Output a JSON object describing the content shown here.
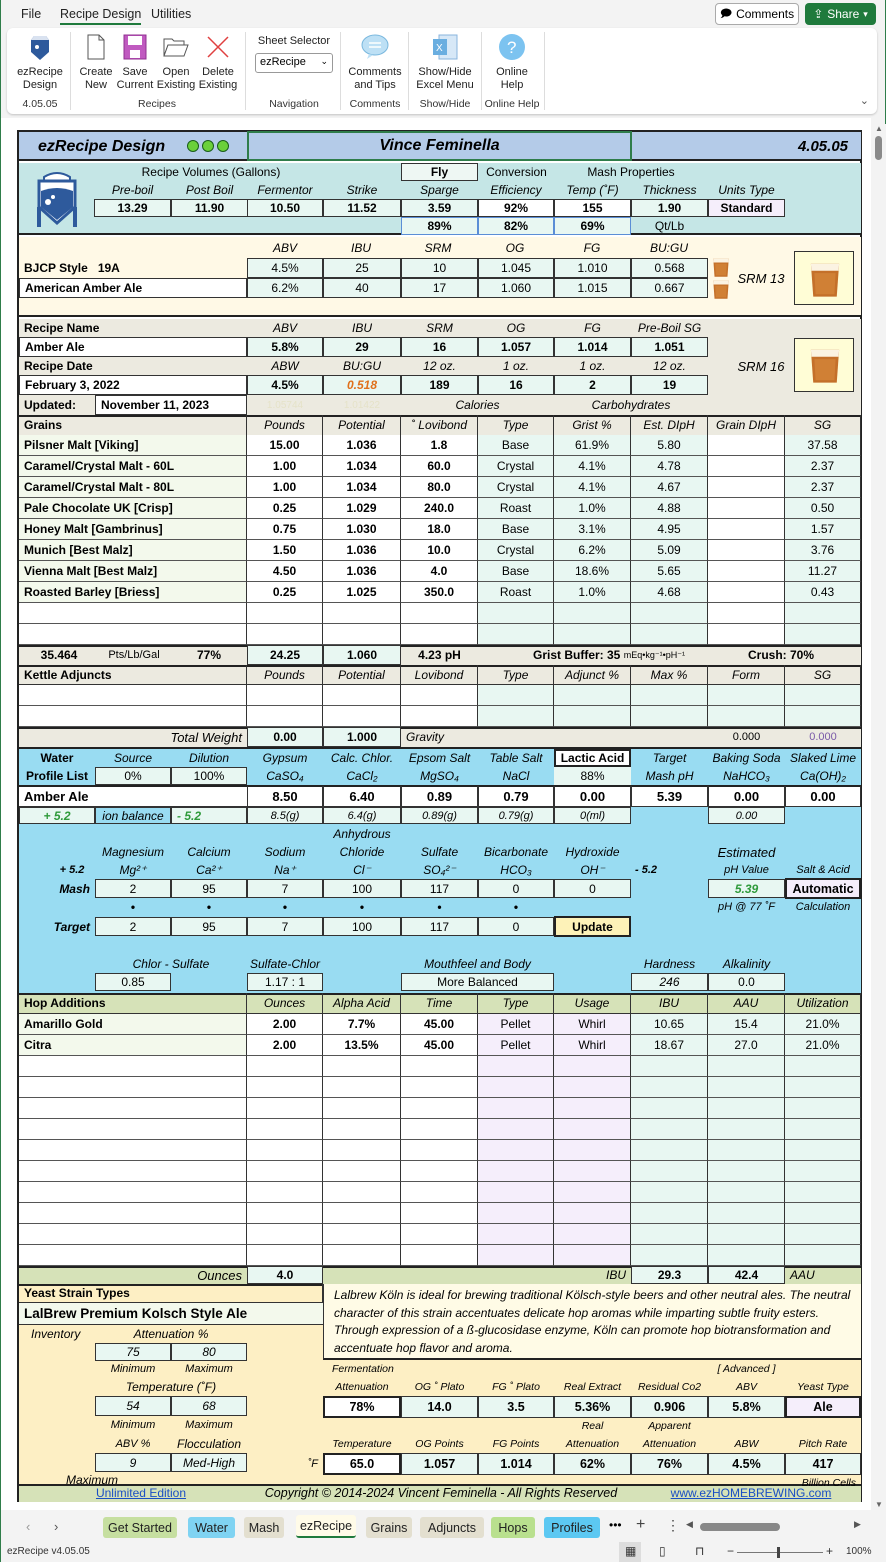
{
  "menubar": {
    "items": [
      "File",
      "Recipe Design",
      "Utilities"
    ],
    "active": "Recipe Design",
    "comments_label": "Comments",
    "share_label": "Share"
  },
  "ribbon": {
    "app_button": {
      "line1": "ezRecipe",
      "line2": "Design",
      "version": "4.05.05"
    },
    "create": {
      "line1": "Create",
      "line2": "New"
    },
    "save": {
      "line1": "Save",
      "line2": "Current"
    },
    "open": {
      "line1": "Open",
      "line2": "Existing"
    },
    "delete": {
      "line1": "Delete",
      "line2": "Existing"
    },
    "recipes_group": "Recipes",
    "sheet_selector_label": "Sheet Selector",
    "sheet_selector_value": "ezRecipe",
    "navigation_group": "Navigation",
    "comments": {
      "line1": "Comments",
      "line2": "and Tips"
    },
    "comments_group": "Comments",
    "showhide": {
      "line1": "Show/Hide",
      "line2": "Excel Menu"
    },
    "showhide_group": "Show/Hide",
    "help": {
      "line1": "Online",
      "line2": "Help"
    },
    "help_group": "Online Help"
  },
  "header": {
    "title": "ezRecipe Design",
    "brewer": "Vince Feminella",
    "version": "4.05.05"
  },
  "volumes": {
    "section_label": "Recipe Volumes (Gallons)",
    "sparge_mode": "Fly",
    "conversion_label": "Conversion",
    "mash_props_label": "Mash Properties",
    "headers": [
      "Pre-boil",
      "Post Boil",
      "Fermentor",
      "Strike",
      "Sparge",
      "Efficiency",
      "Temp (˚F)",
      "Thickness",
      "Units Type"
    ],
    "values": [
      "13.29",
      "11.90",
      "10.50",
      "11.52",
      "3.59",
      "92%",
      "155",
      "1.90",
      "Standard"
    ],
    "row2": [
      "89%",
      "82%",
      "69%",
      "Qt/Lb"
    ]
  },
  "style": {
    "headers": [
      "ABV",
      "IBU",
      "SRM",
      "OG",
      "FG",
      "BU:GU"
    ],
    "bjcp_label": "BJCP Style",
    "bjcp_code": "19A",
    "style_name": "American Amber Ale",
    "min": [
      "4.5%",
      "25",
      "10",
      "1.045",
      "1.010",
      "0.568"
    ],
    "max": [
      "6.2%",
      "40",
      "17",
      "1.060",
      "1.015",
      "0.667"
    ],
    "srm_label": "SRM 13"
  },
  "recipe": {
    "name_label": "Recipe Name",
    "name": "Amber Ale",
    "headers": [
      "ABV",
      "IBU",
      "SRM",
      "OG",
      "FG",
      "Pre-Boil SG"
    ],
    "values": [
      "5.8%",
      "29",
      "16",
      "1.057",
      "1.014",
      "1.051"
    ],
    "date_label": "Recipe Date",
    "date": "February 3, 2022",
    "headers2": [
      "ABW",
      "BU:GU",
      "12 oz.",
      "1 oz.",
      "1 oz.",
      "12 oz."
    ],
    "values2": [
      "4.5%",
      "0.518",
      "189",
      "16",
      "2",
      "19"
    ],
    "updated_label": "Updated:",
    "updated": "November 11, 2023",
    "hidden1": "1.05744",
    "hidden2": "1.01422",
    "calories_label": "Calories",
    "carbs_label": "Carbohydrates",
    "srm_label": "SRM 16"
  },
  "grains": {
    "headers": [
      "Grains",
      "Pounds",
      "Potential",
      "˚ Lovibond",
      "Type",
      "Grist %",
      "Est. DIpH",
      "Grain DIpH",
      "SG"
    ],
    "rows": [
      [
        "Pilsner Malt [Viking]",
        "15.00",
        "1.036",
        "1.8",
        "Base",
        "61.9%",
        "5.80",
        "",
        "37.58"
      ],
      [
        "Caramel/Crystal Malt - 60L",
        "1.00",
        "1.034",
        "60.0",
        "Crystal",
        "4.1%",
        "4.78",
        "",
        "2.37"
      ],
      [
        "Caramel/Crystal Malt - 80L",
        "1.00",
        "1.034",
        "80.0",
        "Crystal",
        "4.1%",
        "4.67",
        "",
        "2.37"
      ],
      [
        "Pale Chocolate UK [Crisp]",
        "0.25",
        "1.029",
        "240.0",
        "Roast",
        "1.0%",
        "4.88",
        "",
        "0.50"
      ],
      [
        "Honey Malt [Gambrinus]",
        "0.75",
        "1.030",
        "18.0",
        "Base",
        "3.1%",
        "4.95",
        "",
        "1.57"
      ],
      [
        "Munich [Best Malz]",
        "1.50",
        "1.036",
        "10.0",
        "Crystal",
        "6.2%",
        "5.09",
        "",
        "3.76"
      ],
      [
        "Vienna Malt [Best Malz]",
        "4.50",
        "1.036",
        "4.0",
        "Base",
        "18.6%",
        "5.65",
        "",
        "11.27"
      ],
      [
        "Roasted Barley [Briess]",
        "0.25",
        "1.025",
        "350.0",
        "Roast",
        "1.0%",
        "4.68",
        "",
        "0.43"
      ],
      [
        "",
        "",
        "",
        "",
        "",
        "",
        "",
        "",
        ""
      ],
      [
        "",
        "",
        "",
        "",
        "",
        "",
        "",
        "",
        ""
      ]
    ],
    "totals": {
      "pts": "35.464",
      "pts_unit": "Pts/Lb/Gal",
      "eff": "77%",
      "pounds": "24.25",
      "gravity": "1.060",
      "ph": "4.23 pH",
      "buffer_label": "Grist Buffer:",
      "buffer": "35",
      "buffer_unit": "mEq•kg⁻¹•pH⁻¹",
      "crush": "Crush: 70%"
    }
  },
  "adjuncts": {
    "headers": [
      "Kettle Adjuncts",
      "Pounds",
      "Potential",
      "Lovibond",
      "Type",
      "Adjunct %",
      "Max %",
      "Form",
      "SG"
    ],
    "rows": [
      [
        "",
        "",
        "",
        "",
        "",
        "",
        "",
        "",
        ""
      ],
      [
        "",
        "",
        "",
        "",
        "",
        "",
        "",
        "",
        ""
      ]
    ],
    "total_weight_label": "Total Weight",
    "total_weight": "0.00",
    "total_gravity": "1.000",
    "gravity_label": "Gravity",
    "form_total": "0.000",
    "sg_total": "0.000"
  },
  "water": {
    "water_label": "Water",
    "profile_list_label": "Profile List",
    "source_label": "Source",
    "source": "0%",
    "dilution_label": "Dilution",
    "dilution": "100%",
    "salt_headers": [
      [
        "Gypsum",
        "CaSO₄"
      ],
      [
        "Calc. Chlor.",
        "CaCl₂"
      ],
      [
        "Epsom Salt",
        "MgSO₄"
      ],
      [
        "Table Salt",
        "NaCl"
      ],
      [
        "Lactic Acid",
        "88%"
      ],
      [
        "Target",
        "Mash pH"
      ],
      [
        "Baking Soda",
        "NaHCO₃"
      ],
      [
        "Slaked Lime",
        "Ca(OH)₂"
      ]
    ],
    "profile": "Amber Ale",
    "salt_values": [
      "8.50",
      "6.40",
      "0.89",
      "0.79",
      "0.00",
      "5.39",
      "0.00",
      "0.00"
    ],
    "ion_plus": "+ 5.2",
    "ion_label": "ion balance",
    "ion_minus": "- 5.2",
    "salt_grams": [
      "8.5(g)",
      "6.4(g)",
      "0.89(g)",
      "0.79(g)",
      "0(ml)",
      "",
      "0.00",
      ""
    ],
    "anhydrous_label": "Anhydrous",
    "ion_headers": [
      [
        "Magnesium",
        "Mg²⁺"
      ],
      [
        "Calcium",
        "Ca²⁺"
      ],
      [
        "Sodium",
        "Na⁺"
      ],
      [
        "Chloride",
        "Cl⁻"
      ],
      [
        "Sulfate",
        "SO₄²⁻"
      ],
      [
        "Bicarbonate",
        "HCO₃"
      ],
      [
        "Hydroxide",
        "OH⁻"
      ]
    ],
    "plus": "+ 5.2",
    "minus": "- 5.2",
    "mash_label": "Mash",
    "mash": [
      "2",
      "95",
      "7",
      "100",
      "117",
      "0",
      "0"
    ],
    "target_label": "Target",
    "target": [
      "2",
      "95",
      "7",
      "100",
      "117",
      "0"
    ],
    "update_label": "Update",
    "est_ph_label1": "Estimated",
    "est_ph_label2": "pH Value",
    "est_ph": "5.39",
    "ph_temp_label": "pH @ 77 ˚F",
    "salt_acid_label": "Salt & Acid",
    "salt_acid_value": "Automatic",
    "calc_label": "Calculation",
    "chlor_sulfate_label": "Chlor - Sulfate",
    "chlor_sulfate": "0.85",
    "sulfate_chlor_label": "Sulfate-Chlor",
    "sulfate_chlor": "1.17 : 1",
    "mouthfeel_label": "Mouthfeel and Body",
    "mouthfeel": "More Balanced",
    "hardness_label": "Hardness",
    "hardness": "246",
    "alkalinity_label": "Alkalinity",
    "alkalinity": "0.0"
  },
  "hops": {
    "headers": [
      "Hop Additions",
      "Ounces",
      "Alpha Acid",
      "Time",
      "Type",
      "Usage",
      "IBU",
      "AAU",
      "Utilization"
    ],
    "rows": [
      [
        "Amarillo Gold",
        "2.00",
        "7.7%",
        "45.00",
        "Pellet",
        "Whirl",
        "10.65",
        "15.4",
        "21.0%"
      ],
      [
        "Citra",
        "2.00",
        "13.5%",
        "45.00",
        "Pellet",
        "Whirl",
        "18.67",
        "27.0",
        "21.0%"
      ],
      [
        "",
        "",
        "",
        "",
        "",
        "",
        "",
        "",
        ""
      ],
      [
        "",
        "",
        "",
        "",
        "",
        "",
        "",
        "",
        ""
      ],
      [
        "",
        "",
        "",
        "",
        "",
        "",
        "",
        "",
        ""
      ],
      [
        "",
        "",
        "",
        "",
        "",
        "",
        "",
        "",
        ""
      ],
      [
        "",
        "",
        "",
        "",
        "",
        "",
        "",
        "",
        ""
      ],
      [
        "",
        "",
        "",
        "",
        "",
        "",
        "",
        "",
        ""
      ],
      [
        "",
        "",
        "",
        "",
        "",
        "",
        "",
        "",
        ""
      ],
      [
        "",
        "",
        "",
        "",
        "",
        "",
        "",
        "",
        ""
      ],
      [
        "",
        "",
        "",
        "",
        "",
        "",
        "",
        "",
        ""
      ],
      [
        "",
        "",
        "",
        "",
        "",
        "",
        "",
        "",
        ""
      ]
    ],
    "ounces_label": "Ounces",
    "ounces_total": "4.0",
    "ibu_label": "IBU",
    "ibu_total": "29.3",
    "aau_total": "42.4",
    "aau_label": "AAU"
  },
  "yeast": {
    "types_label": "Yeast Strain Types",
    "strain": "LalBrew Premium Kolsch Style Ale",
    "description": "Lalbrew Köln is ideal for brewing traditional Kölsch-style beers and other neutral ales. The neutral character of this strain accentuates delicate hop aromas while imparting subtle fruity esters. Through expression of a ß-glucosidase enzyme, Köln can promote hop biotransformation and accentuate hop flavor and aroma.",
    "inventory_label": "Inventory",
    "attenuation_label": "Attenuation %",
    "att_min": "75",
    "att_max": "80",
    "minimum_label": "Minimum",
    "maximum_label": "Maximum",
    "temp_label": "Temperature (˚F)",
    "temp_min": "54",
    "temp_max": "68",
    "abv_label": "ABV %",
    "floc_label": "Flocculation",
    "abv_max": "9",
    "floc": "Med-High",
    "abv_max_label": "Maximum",
    "ferm_label": "Fermentation",
    "advanced_label": "[ Advanced ]",
    "row1_headers": [
      "Attenuation",
      "OG ˚ Plato",
      "FG ˚ Plato",
      "Real Extract",
      "Residual Co2",
      "ABV",
      "Yeast Type"
    ],
    "row1_values": [
      "78%",
      "14.0",
      "3.5",
      "5.36%",
      "0.906",
      "5.8%",
      "Ale"
    ],
    "real_label": "Real",
    "apparent_label": "Apparent",
    "row2_headers": [
      "Temperature",
      "OG  Points",
      "FG  Points",
      "Attenuation",
      "Attenuation",
      "ABW",
      "Pitch Rate"
    ],
    "row2_values": [
      "65.0",
      "1.057",
      "1.014",
      "62%",
      "76%",
      "4.5%",
      "417"
    ],
    "deg_f": "˚F",
    "billion_label": "Billion Cells"
  },
  "footer": {
    "edition": "Unlimited Edition",
    "copyright": "Copyright © 2014-2024 Vincent Feminella - All Rights Reserved",
    "website": "www.ezHOMEBREWING.com"
  },
  "sheet_tabs": [
    {
      "label": "Get Started",
      "color": "#c6dfa0"
    },
    {
      "label": "Water",
      "color": "#7fd3f2"
    },
    {
      "label": "Mash",
      "color": "#e3dfcf"
    },
    {
      "label": "ezRecipe",
      "color": "#fff9d9"
    },
    {
      "label": "Grains",
      "color": "#e3dfcf"
    },
    {
      "label": "Adjuncts",
      "color": "#e3dfcf"
    },
    {
      "label": "Hops",
      "color": "#b9e08e"
    },
    {
      "label": "Profiles",
      "color": "#5cc8f2"
    }
  ],
  "active_sheet": "ezRecipe",
  "status": {
    "left": "ezRecipe v4.05.05",
    "zoom": "100%"
  },
  "colors": {
    "header_blue": "#b4cbe8",
    "volumes_teal": "#c5e6e6",
    "cream": "#fff9e6",
    "beige": "#eceae0",
    "water_blue": "#99dcf2",
    "olive": "#d6e2b8",
    "yeast": "#fdefc4",
    "accent_green": "#1f7a3c"
  }
}
